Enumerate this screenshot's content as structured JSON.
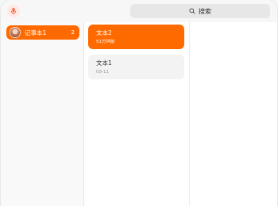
{
  "search": {
    "label": "搜索"
  },
  "sidebar": {
    "notebooks": [
      {
        "label": "记事本1",
        "count": "2"
      }
    ]
  },
  "notes": [
    {
      "title": "文本2",
      "time": "51分钟前"
    },
    {
      "title": "文本1",
      "time": "09-11"
    }
  ],
  "colors": {
    "accent": "#ff6a00",
    "background": "#f7f7f7"
  },
  "icons": [
    "microphone-icon",
    "search-icon"
  ]
}
